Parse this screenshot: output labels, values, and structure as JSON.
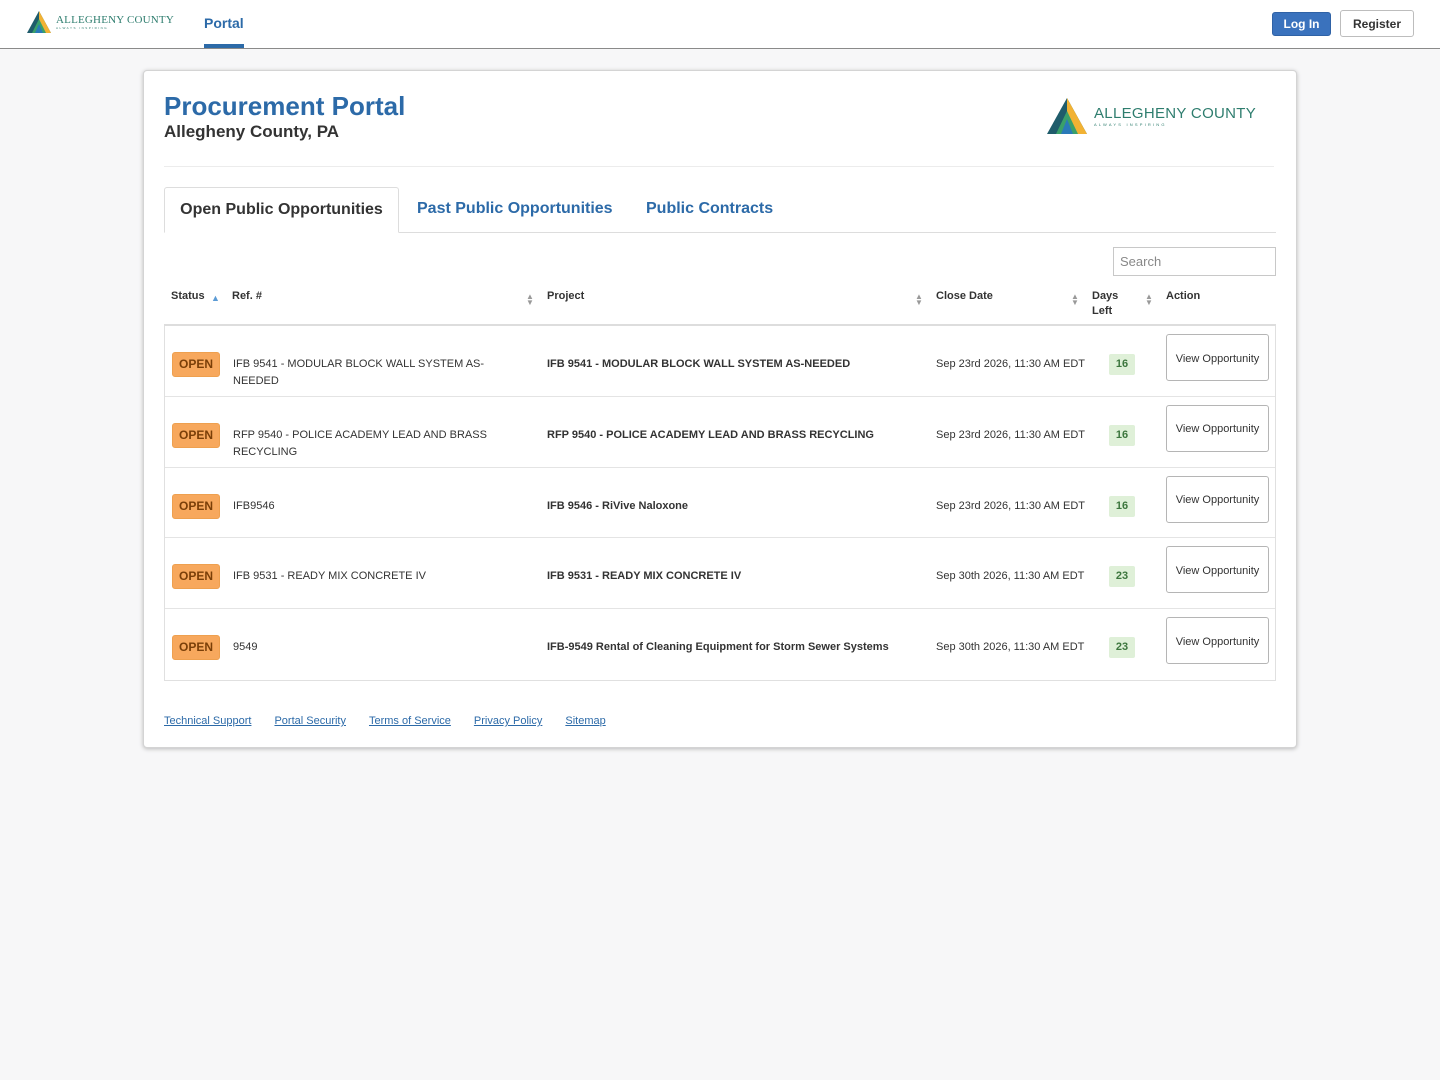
{
  "nav": {
    "logo_name": "ALLEGHENY COUNTY",
    "logo_tagline": "ALWAYS INSPIRING",
    "tab_portal": "Portal",
    "login_label": "Log In",
    "register_label": "Register"
  },
  "header": {
    "title": "Procurement Portal",
    "subtitle": "Allegheny County, PA",
    "logo_name": "ALLEGHENY COUNTY",
    "logo_tagline": "ALWAYS INSPIRING"
  },
  "tabs": {
    "open": "Open Public Opportunities",
    "past": "Past Public Opportunities",
    "contracts": "Public Contracts"
  },
  "search": {
    "placeholder": "Search"
  },
  "table": {
    "columns": {
      "status": "Status",
      "ref": "Ref. #",
      "project": "Project",
      "close_date": "Close Date",
      "days_left_1": "Days",
      "days_left_2": "Left",
      "action": "Action"
    },
    "rows": [
      {
        "status": "OPEN",
        "ref": "IFB 9541 - MODULAR BLOCK WALL SYSTEM AS-NEEDED",
        "project": "IFB 9541 - MODULAR BLOCK WALL SYSTEM AS-NEEDED",
        "close_date": "Sep 23rd 2026, 11:30 AM EDT",
        "days_left": "16",
        "action": "View Opportunity"
      },
      {
        "status": "OPEN",
        "ref": "RFP 9540 - POLICE ACADEMY LEAD AND BRASS RECYCLING",
        "project": "RFP 9540 - POLICE ACADEMY LEAD AND BRASS RECYCLING",
        "close_date": "Sep 23rd 2026, 11:30 AM EDT",
        "days_left": "16",
        "action": "View Opportunity"
      },
      {
        "status": "OPEN",
        "ref": "IFB9546",
        "project": "IFB 9546 - RiVive Naloxone",
        "close_date": "Sep 23rd 2026, 11:30 AM EDT",
        "days_left": "16",
        "action": "View Opportunity"
      },
      {
        "status": "OPEN",
        "ref": "IFB 9531 - READY MIX CONCRETE IV",
        "project": "IFB 9531 - READY MIX CONCRETE IV",
        "close_date": "Sep 30th 2026, 11:30 AM EDT",
        "days_left": "23",
        "action": "View Opportunity"
      },
      {
        "status": "OPEN",
        "ref": "9549",
        "project": "IFB-9549 Rental of Cleaning Equipment for Storm Sewer Systems",
        "close_date": "Sep 30th 2026, 11:30 AM EDT",
        "days_left": "23",
        "action": "View Opportunity"
      }
    ]
  },
  "footer": {
    "technical_support": "Technical Support",
    "portal_security": "Portal Security",
    "terms": "Terms of Service",
    "privacy": "Privacy Policy",
    "sitemap": "Sitemap"
  },
  "colors": {
    "brand_blue": "#2c6aa8",
    "login_blue": "#3a72bd",
    "badge_orange": "#f7a85d",
    "days_green_bg": "#dff0d8",
    "days_green_text": "#3c763d",
    "logo_teal": "#2e7d6e"
  },
  "icons": {
    "logo": "allegheny-triangle-logo",
    "sort_asc": "sort-asc-icon",
    "sort_both": "sort-both-icon"
  }
}
